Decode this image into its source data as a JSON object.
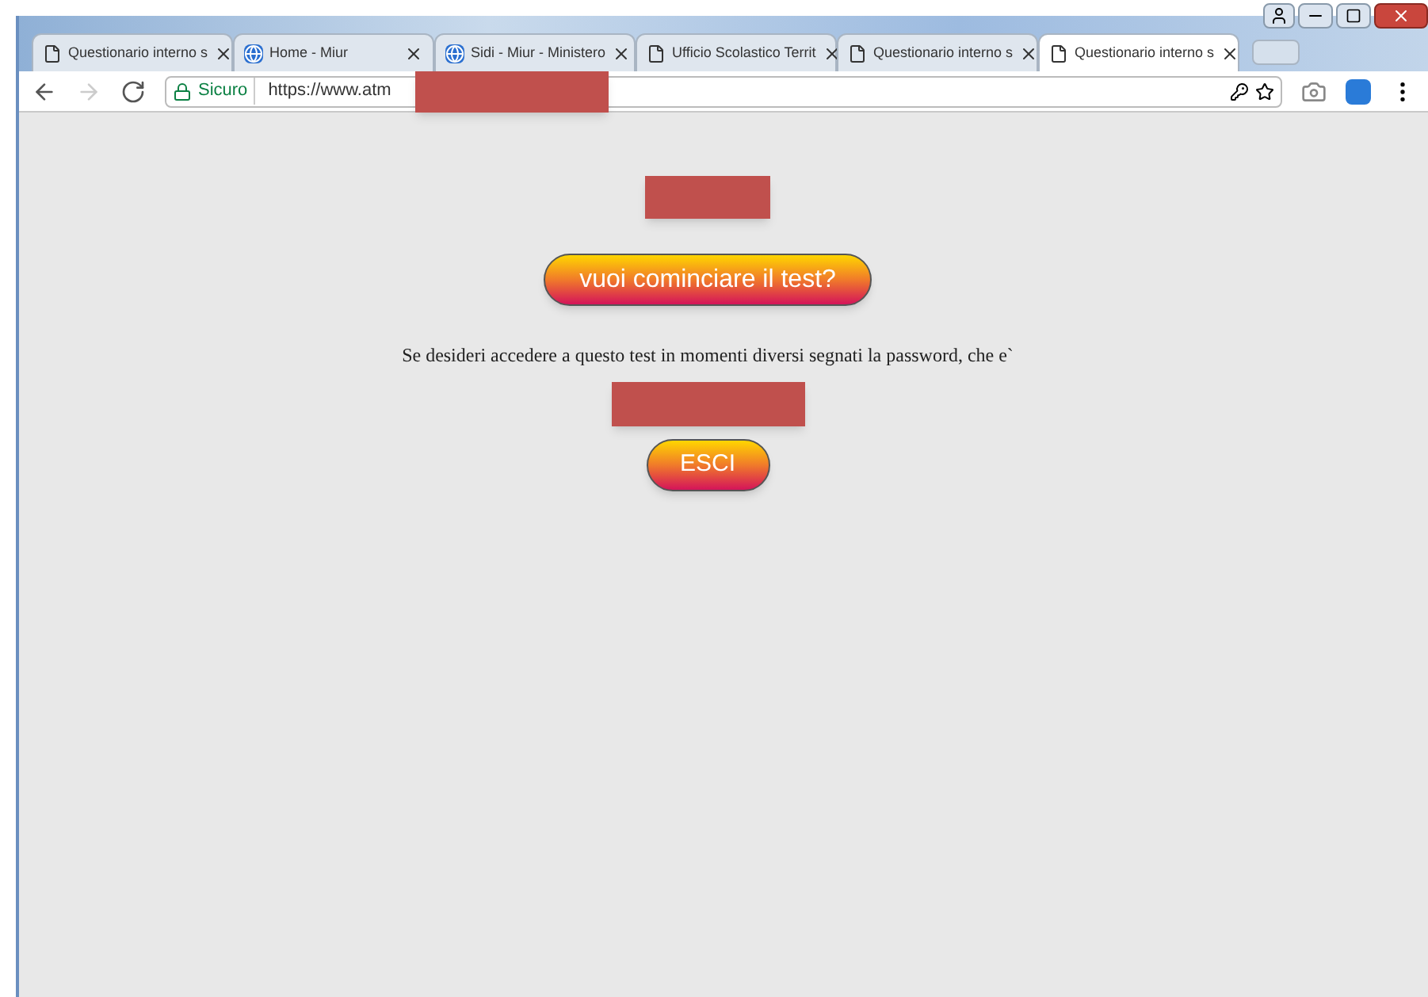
{
  "tabs": [
    {
      "label": "Questionario interno s",
      "kind": "page",
      "selected": false
    },
    {
      "label": "Home - Miur",
      "kind": "site",
      "selected": false
    },
    {
      "label": "Sidi - Miur - Ministero",
      "kind": "site",
      "selected": false
    },
    {
      "label": "Ufficio Scolastico Territ",
      "kind": "page",
      "selected": false
    },
    {
      "label": "Questionario interno s",
      "kind": "page",
      "selected": false
    },
    {
      "label": "Questionario interno s",
      "kind": "page",
      "selected": true
    }
  ],
  "address_bar": {
    "security": "Sicuro",
    "url": "https://www.atm"
  },
  "page": {
    "start_button": "vuoi cominciare il test?",
    "message": "Se desideri accedere a questo test in momenti diversi segnati la password, che e`",
    "exit_button": "ESCI"
  }
}
